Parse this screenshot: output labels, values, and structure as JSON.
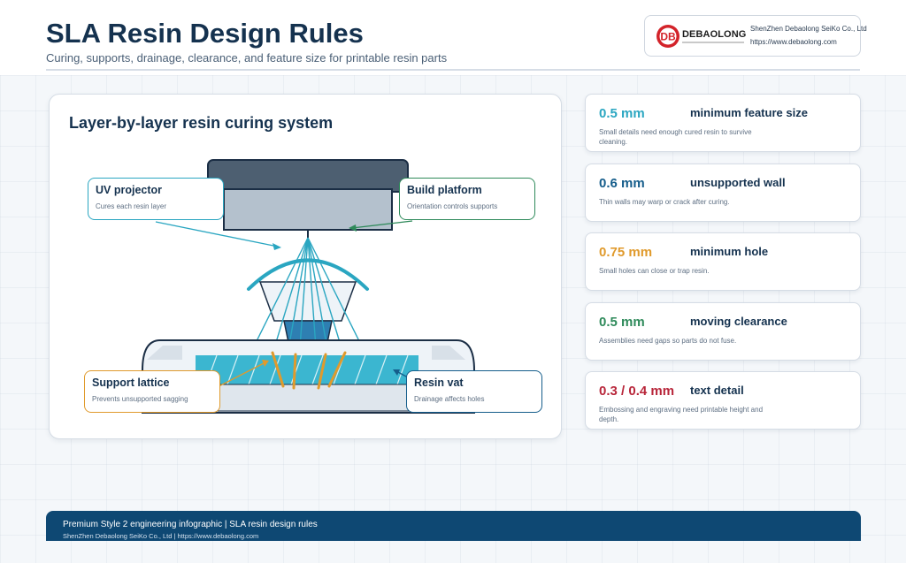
{
  "header": {
    "title": "SLA Resin Design Rules",
    "subtitle": "Curing, supports, drainage, clearance, and feature size for printable resin parts"
  },
  "logo": {
    "mark": "DB",
    "wordmark": "DEBAOLONG",
    "company": "ShenZhen Debaolong SeiKo Co., Ltd",
    "url": "https://www.debaolong.com"
  },
  "diagram": {
    "title": "Layer-by-layer resin curing system",
    "callouts": [
      {
        "title": "UV projector",
        "desc": "Cures each resin layer"
      },
      {
        "title": "Build platform",
        "desc": "Orientation controls supports"
      },
      {
        "title": "Support lattice",
        "desc": "Prevents unsupported sagging"
      },
      {
        "title": "Resin vat",
        "desc": "Drainage affects holes"
      }
    ]
  },
  "specs": [
    {
      "value": "0.5 mm",
      "label": "minimum feature size",
      "desc": "Small details need enough cured resin to survive cleaning.",
      "color": "#2aa6c1"
    },
    {
      "value": "0.6 mm",
      "label": "unsupported wall",
      "desc": "Thin walls may warp or crack after curing.",
      "color": "#155d8b"
    },
    {
      "value": "0.75 mm",
      "label": "minimum hole",
      "desc": "Small holes can close or trap resin.",
      "color": "#e09a2c"
    },
    {
      "value": "0.5 mm",
      "label": "moving clearance",
      "desc": "Assemblies need gaps so parts do not fuse.",
      "color": "#2e8a5a"
    },
    {
      "value": "0.3 / 0.4 mm",
      "label": "text detail",
      "desc": "Embossing and engraving need printable height and depth.",
      "color": "#b8263a"
    }
  ],
  "footer": {
    "line1": "Premium Style 2 engineering infographic | SLA resin design rules",
    "line2": "ShenZhen Debaolong SeiKo Co., Ltd  |  https://www.debaolong.com"
  }
}
